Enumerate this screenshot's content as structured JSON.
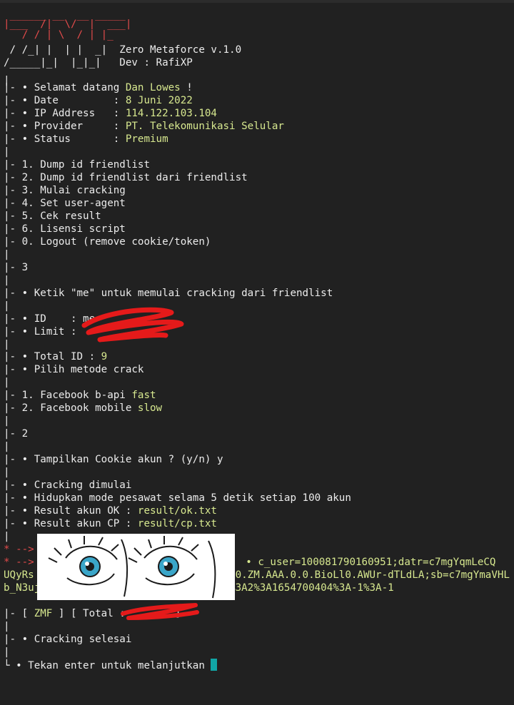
{
  "banner": {
    "logo_line1": " ______ __  __ _____",
    "logo_line2": "|___  /|  \\/  |  ___|",
    "logo_line3": "   / / | \\  / | |_",
    "logo_line4": "  / /_ | |\\/| |  _|",
    "logo_line5": " /_____|_|  |_|_|",
    "logo3_prefix": " / /_| |  | |  _|  ",
    "app_name": "Zero Metaforce v.1.0",
    "logo4_prefix": "/_____|_|  |_|_|   ",
    "dev": "Dev : RafiXP"
  },
  "info": {
    "welcome_label": "|- • Selamat datang ",
    "welcome_name": "Dan Lowes",
    "welcome_end": " !",
    "date_label": "|- • Date         : ",
    "date_value": "8 Juni 2022",
    "ip_label": "|- • IP Address   : ",
    "ip_value": "114.122.103.104",
    "provider_label": "|- • Provider     : ",
    "provider_value": "PT. Telekomunikasi Selular",
    "status_label": "|- • Status       : ",
    "status_value": "Premium"
  },
  "menu": [
    "|- 1. Dump id friendlist",
    "|- 2. Dump id friendlist dari friendlist",
    "|- 3. Mulai cracking",
    "|- 4. Set user-agent",
    "|- 5. Cek result",
    "|- 6. Lisensi script",
    "|- 0. Logout (remove cookie/token)"
  ],
  "pipe": "|",
  "choice1": "|- 3",
  "hint_prefix": "|- • Ketik ",
  "hint_me": "\"me\"",
  "hint_suffix": " untuk memulai cracking dari friendlist",
  "id_line": "|- • ID    : me",
  "limit_line": "|- • Limit : ",
  "total_id_label": "|- • Total ID : ",
  "total_id_value": "9",
  "method_prompt": "|- • Pilih metode crack",
  "method1_label": "|- 1. Facebook b-api ",
  "method1_speed": "fast",
  "method2_label": "|- 2. Facebook mobile ",
  "method2_speed": "slow",
  "choice2": "|- 2",
  "cookie_prompt": "|- • Tampilkan Cookie akun ? (y/n) y",
  "crack_start": "|- • Cracking dimulai",
  "airplane": "|- • Hidupkan mode pesawat selama 5 detik setiap 100 akun",
  "ok_label": "|- • Result akun OK : ",
  "ok_path": "result/ok.txt",
  "cp_label": "|- • Result akun CP : ",
  "cp_path": "result/cp.txt",
  "arrow1": "* -->",
  "arrow2": "* -->",
  "cookie_first": " • c_user=100081790160951;datr=c7mgYqmLeCQ",
  "cookie_text": "UQyRs                                   WXgzIL6q35eZ04GGefxGJ7yoQw.BioLl0.ZM.AAA.0.0.BioLl0.AWUr-dTLdLA;sb=c7mgYmaVHLb_N3ujJpL6Lu6z;xs=38%3AP1eJGuUaEgSI3g%3A2%3A1654700404%3A-1%3A-1",
  "zmf_open": "|- [ ",
  "zmf_tag": "ZMF",
  "zmf_close": " ] [ Total : ",
  "zmf_end": " ]",
  "crack_done": "|- • Cracking selesai",
  "enter_prompt": "└ • Tekan enter untuk melanjutkan "
}
